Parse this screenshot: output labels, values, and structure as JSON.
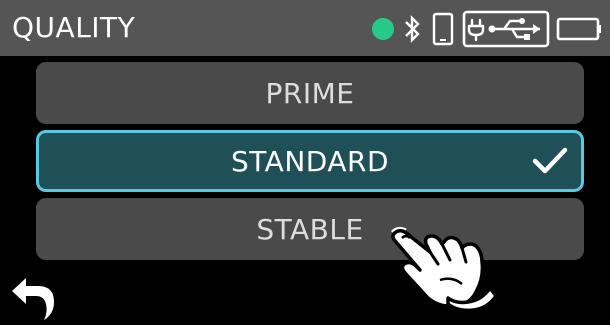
{
  "header": {
    "title": "QUALITY",
    "status_icons": [
      {
        "icon": "status-dot-icon",
        "color": "#25c98a"
      },
      {
        "icon": "bluetooth-icon"
      },
      {
        "icon": "smartphone-icon"
      },
      {
        "icon": "usb-power-icon"
      },
      {
        "icon": "battery-icon"
      }
    ]
  },
  "options": [
    {
      "label": "PRIME",
      "selected": false
    },
    {
      "label": "STANDARD",
      "selected": true
    },
    {
      "label": "STABLE",
      "selected": false
    }
  ],
  "footer": {
    "back_icon": "back-arrow-icon"
  },
  "overlay": {
    "hand_icon": "pointing-hand-icon"
  },
  "colors": {
    "header_bg": "#555555",
    "option_bg": "#4a4a4a",
    "selected_bg": "#1f4f57",
    "selected_border": "#5ac8df",
    "status_dot": "#25c98a"
  }
}
